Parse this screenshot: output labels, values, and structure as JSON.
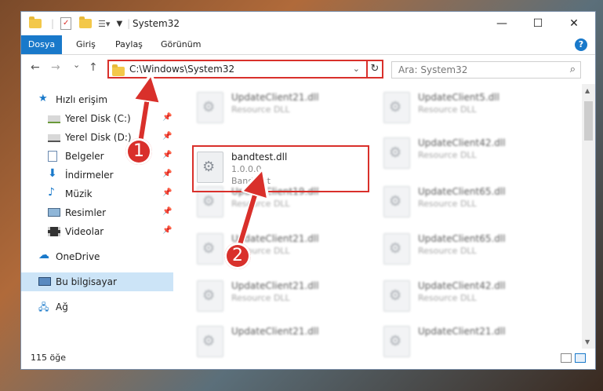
{
  "window": {
    "title": "System32"
  },
  "window_controls": {
    "minimize": "—",
    "maximize": "☐",
    "close": "✕"
  },
  "ribbon": {
    "tabs": [
      "Dosya",
      "Giriş",
      "Paylaş",
      "Görünüm"
    ],
    "help": "?"
  },
  "nav": {
    "back": "←",
    "forward": "→",
    "recent": "⌄",
    "up": "↑"
  },
  "address": {
    "path": "C:\\Windows\\System32",
    "chevron": "⌄",
    "refresh": "↻"
  },
  "search": {
    "placeholder": "Ara: System32",
    "icon": "⌕"
  },
  "sidebar": {
    "items": [
      {
        "label": "Hızlı erişim",
        "icon": "star-icon"
      },
      {
        "label": "Yerel Disk (C:)",
        "icon": "drive-icon",
        "pin": "📌"
      },
      {
        "label": "Yerel Disk (D:)",
        "icon": "drive-icon",
        "pin": "📌"
      },
      {
        "label": "Belgeler",
        "icon": "documents-icon",
        "pin": "📌"
      },
      {
        "label": "İndirmeler",
        "icon": "download-icon",
        "pin": "📌"
      },
      {
        "label": "Müzik",
        "icon": "music-icon",
        "pin": "📌"
      },
      {
        "label": "Resimler",
        "icon": "pictures-icon",
        "pin": "📌"
      },
      {
        "label": "Videolar",
        "icon": "videos-icon",
        "pin": "📌"
      },
      {
        "label": "OneDrive",
        "icon": "cloud-icon"
      },
      {
        "label": "Bu bilgisayar",
        "icon": "computer-icon"
      },
      {
        "label": "Ağ",
        "icon": "network-icon"
      }
    ]
  },
  "files": [
    {
      "name": "UpdateClient21.dll",
      "desc": "Resource DLL"
    },
    {
      "name": "UpdateClient5.dll",
      "desc": "Resource DLL"
    },
    {
      "name": "bandtest.dll",
      "version": "1.0.0.0",
      "company": "BandTest"
    },
    {
      "name": "UpdateClient42.dll",
      "desc": "Resource DLL"
    },
    {
      "name": "UpdateClient19.dll",
      "desc": "Resource DLL"
    },
    {
      "name": "UpdateClient65.dll",
      "desc": "Resource DLL"
    },
    {
      "name": "UpdateClient21.dll",
      "desc": "Resource DLL"
    },
    {
      "name": "UpdateClient65.dll",
      "desc": "Resource DLL"
    },
    {
      "name": "UpdateClient21.dll",
      "desc": "Resource DLL"
    },
    {
      "name": "UpdateClient42.dll",
      "desc": "Resource DLL"
    },
    {
      "name": "UpdateClient21.dll",
      "desc": "Resource DLL"
    },
    {
      "name": "UpdateClient21.dll",
      "desc": "Resource DLL"
    }
  ],
  "status": {
    "count": "115 öğe"
  },
  "annotations": {
    "step1": "1",
    "step2": "2"
  },
  "colors": {
    "accent": "#1979ca",
    "highlight": "#d9302b",
    "selected": "#cce4f7"
  }
}
